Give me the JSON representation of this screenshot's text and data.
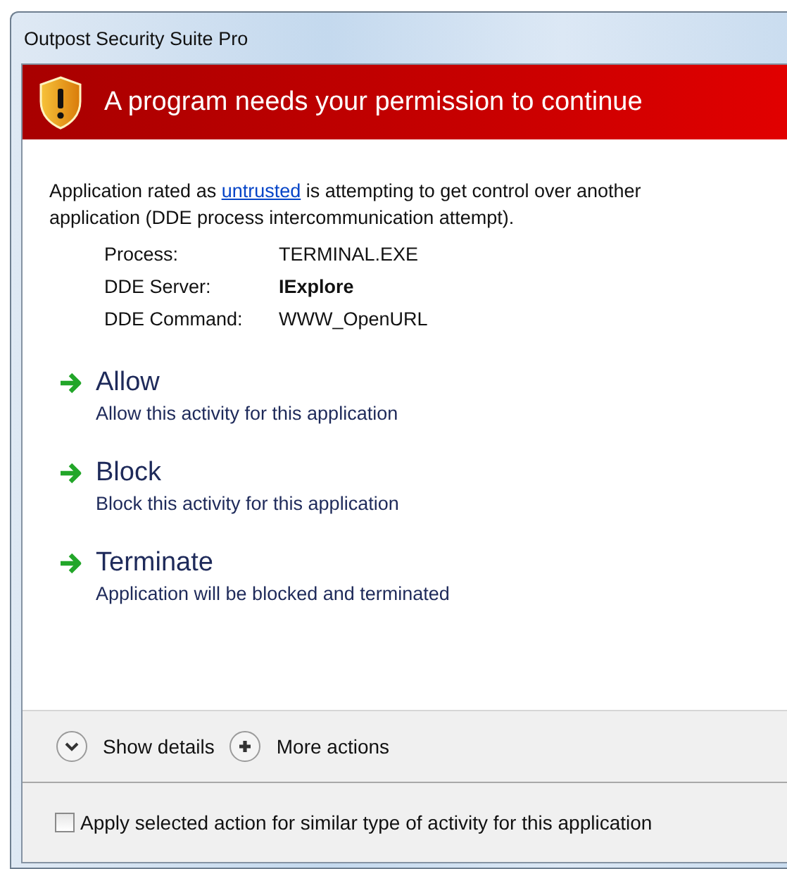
{
  "window": {
    "title": "Outpost Security Suite Pro"
  },
  "banner": {
    "title": "A program needs your permission to continue"
  },
  "message": {
    "before": "Application rated as ",
    "link": "untrusted",
    "after": " is attempting to get control over another application (DDE process intercommunication attempt)."
  },
  "details": [
    {
      "label": "Process:",
      "value": "TERMINAL.EXE",
      "bold": false
    },
    {
      "label": "DDE Server:",
      "value": "IExplore",
      "bold": true
    },
    {
      "label": "DDE Command:",
      "value": "WWW_OpenURL",
      "bold": false
    }
  ],
  "actions": [
    {
      "title": "Allow",
      "description": "Allow this activity for this application"
    },
    {
      "title": "Block",
      "description": "Block this activity for this application"
    },
    {
      "title": "Terminate",
      "description": "Application will be blocked and terminated"
    }
  ],
  "footer_buttons": [
    {
      "kind": "expand",
      "label": "Show details"
    },
    {
      "kind": "plus",
      "label": "More actions"
    }
  ],
  "apply_similar": {
    "label": "Apply selected action for similar type of activity for this application",
    "checked": false
  }
}
